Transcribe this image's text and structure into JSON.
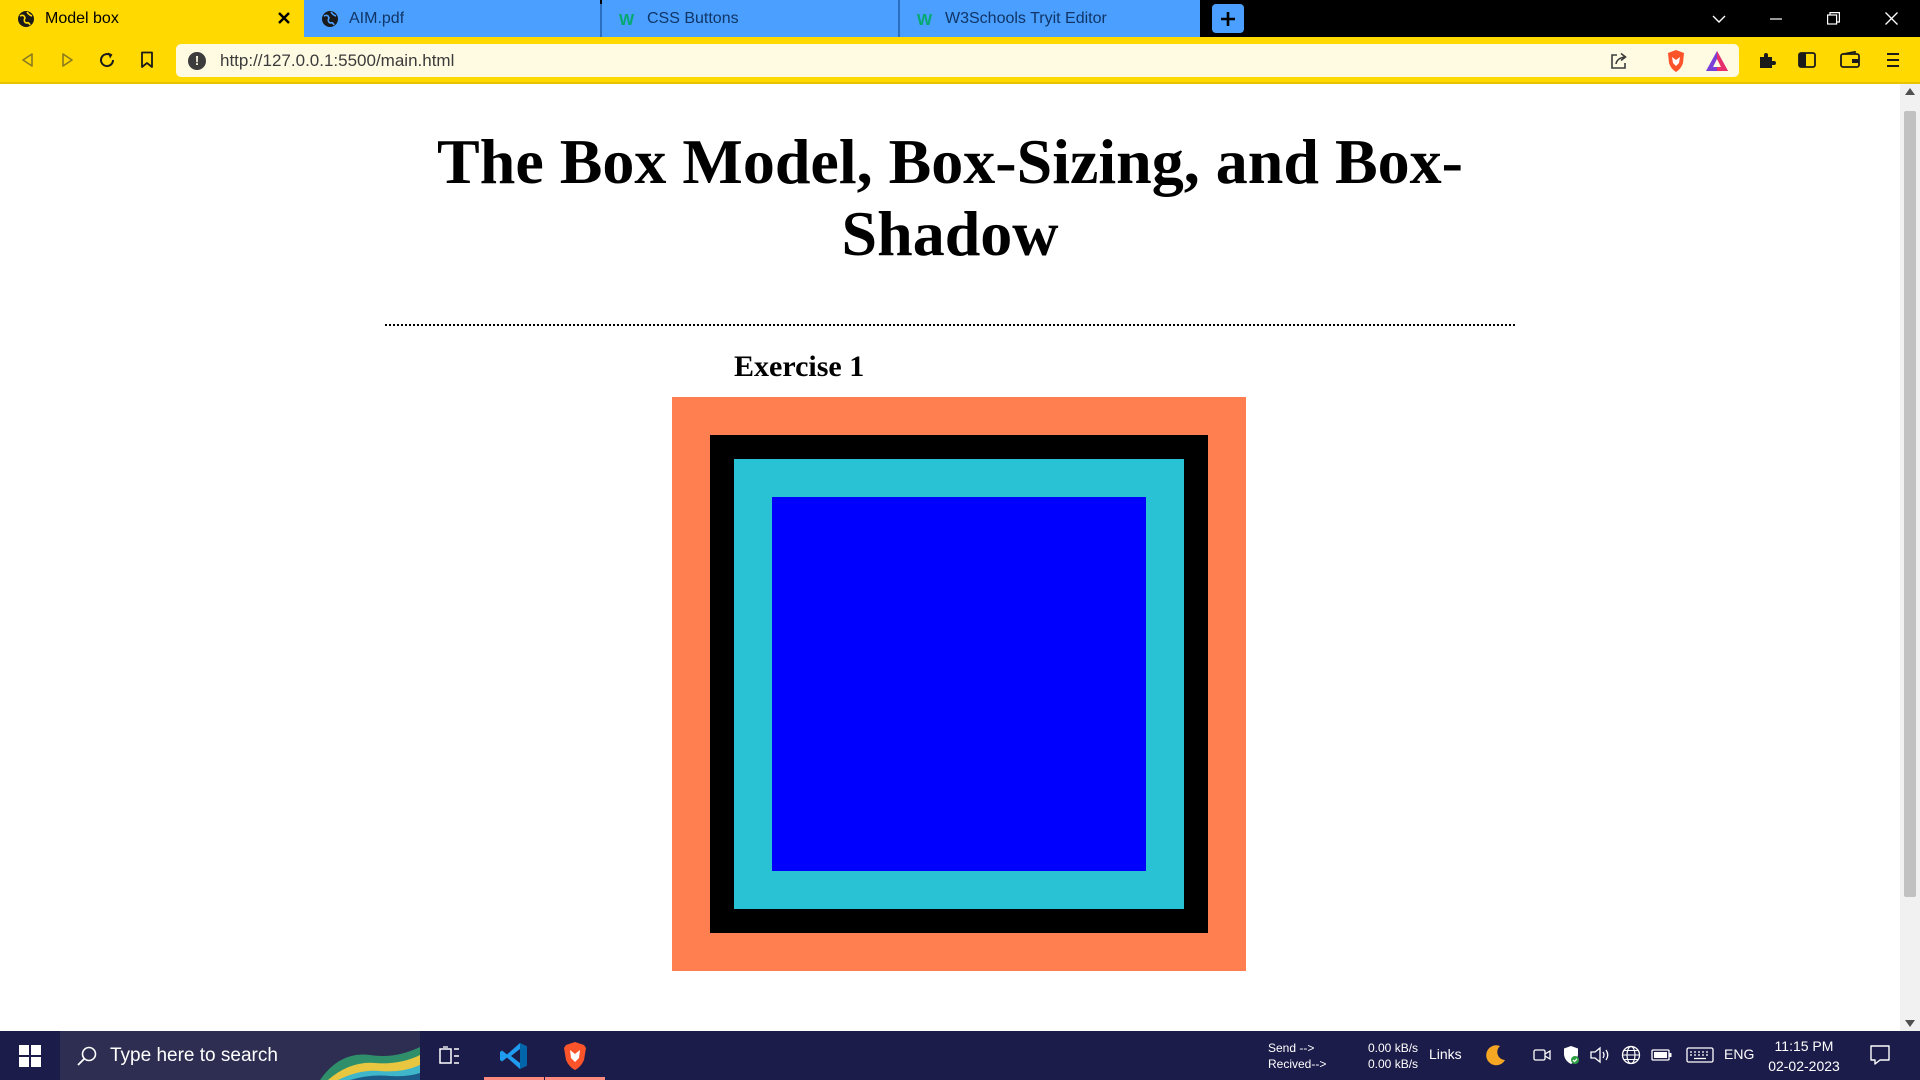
{
  "browser": {
    "tabs": [
      {
        "title": "Model box",
        "active": true,
        "icon": "globe-icon"
      },
      {
        "title": "AIM.pdf",
        "active": false,
        "icon": "globe-icon"
      },
      {
        "title": "CSS Buttons",
        "active": false,
        "icon": "w3schools-icon"
      },
      {
        "title": "W3Schools Tryit Editor",
        "active": false,
        "icon": "w3schools-icon"
      }
    ],
    "url": "http://127.0.0.1:5500/main.html",
    "colors": {
      "chrome": "#ffd900",
      "inactive_tab": "#4a9fff"
    }
  },
  "page": {
    "title": "The Box Model, Box-Sizing, and Box-Shadow",
    "exercise_heading": "Exercise 1",
    "box_colors": {
      "margin": "#ff7f50",
      "border": "#000000",
      "padding": "#29c2d4",
      "content": "#0000ff"
    }
  },
  "taskbar": {
    "search_placeholder": "Type here to search",
    "net_send_label": "Send -->",
    "net_received_label": "Recived-->",
    "net_send_value": "0.00 kB/s",
    "net_received_value": "0.00 kB/s",
    "links_label": "Links",
    "language": "ENG",
    "time": "11:15 PM",
    "date": "02-02-2023"
  }
}
